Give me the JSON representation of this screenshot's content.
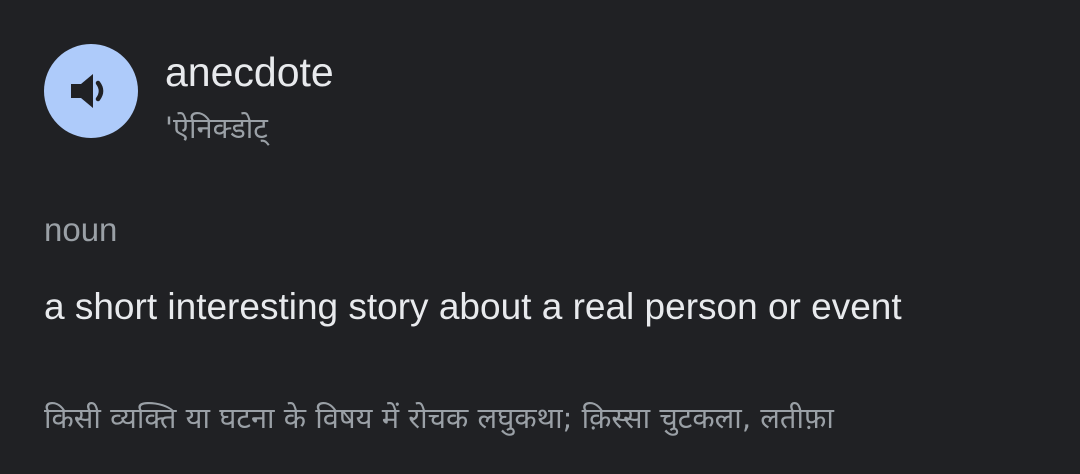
{
  "entry": {
    "word": "anecdote",
    "pronunciation": "'ऐनिक्डोट्",
    "part_of_speech": "noun",
    "definition": "a short interesting story about a real person or event",
    "translation": "किसी व्यक्ति या घटना के विषय में रोचक लघुकथा; क़िस्सा चुटकला, लतीफ़ा"
  },
  "icons": {
    "speaker": "speaker-icon"
  },
  "colors": {
    "background": "#202124",
    "accent_button": "#aecbfa",
    "icon": "#202124",
    "primary_text": "#e8eaed",
    "secondary_text": "#9aa0a6"
  }
}
